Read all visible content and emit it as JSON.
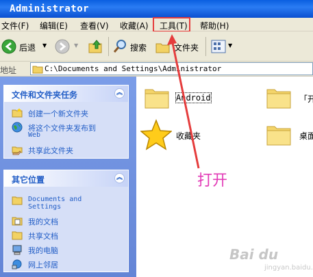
{
  "window": {
    "title": "Administrator"
  },
  "menu": [
    "文件(F)",
    "编辑(E)",
    "查看(V)",
    "收藏(A)",
    "工具(T)",
    "帮助(H)"
  ],
  "toolbar": {
    "back": "后退",
    "search": "搜索",
    "folders": "文件夹"
  },
  "address": {
    "label": "地址",
    "path": "C:\\Documents and Settings\\Administrator"
  },
  "tasks_panel": {
    "title": "文件和文件夹任务",
    "items": [
      "创建一个新文件夹",
      "将这个文件夹发布到",
      "Web",
      "共享此文件夹"
    ]
  },
  "places_panel": {
    "title": "其它位置",
    "items": [
      "Documents and",
      "Settings",
      "我的文档",
      "共享文档",
      "我的电脑",
      "网上邻居"
    ]
  },
  "files": [
    "Android",
    "「开",
    "收藏夹",
    "桌面"
  ],
  "annotation": "打开",
  "watermark": {
    "main": "Bai du",
    "sub": "jingyan.baidu.com"
  },
  "colors": {
    "accent_red": "#e53c3c",
    "annotation_pink": "#e23ab6",
    "link_blue": "#215dc6"
  }
}
